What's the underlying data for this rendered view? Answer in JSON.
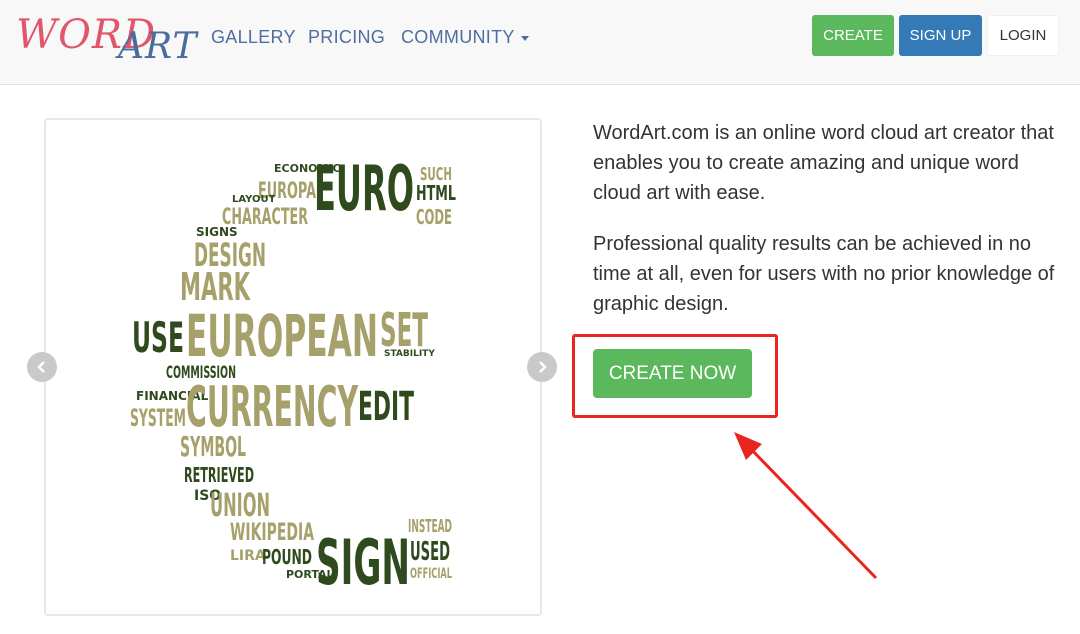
{
  "header": {
    "logo": {
      "word": "WORD",
      "art": "ART"
    },
    "nav": {
      "gallery": "GALLERY",
      "pricing": "PRICING",
      "community": "COMMUNITY"
    },
    "buttons": {
      "create": "CREATE",
      "signup": "SIGN UP",
      "login": "LOGIN"
    }
  },
  "main": {
    "description_1": "WordArt.com is an online word cloud art creator that enables you to create amazing and unique word cloud art with ease.",
    "description_2": "Professional quality results can be achieved in no time at all, even for users with no prior knowledge of graphic design.",
    "create_now": "CREATE NOW"
  },
  "word_cloud": {
    "words": [
      {
        "t": "EURO",
        "c": "dark"
      },
      {
        "t": "EUROPA",
        "c": "olive"
      },
      {
        "t": "ECONOMIC",
        "c": "dark"
      },
      {
        "t": "SUCH",
        "c": "olive"
      },
      {
        "t": "HTML",
        "c": "dark"
      },
      {
        "t": "CODE",
        "c": "olive"
      },
      {
        "t": "CHARACTER",
        "c": "olive"
      },
      {
        "t": "LAYOUT",
        "c": "dark"
      },
      {
        "t": "DESIGN",
        "c": "olive"
      },
      {
        "t": "SIGNS",
        "c": "dark"
      },
      {
        "t": "MARK",
        "c": "olive"
      },
      {
        "t": "USE",
        "c": "dark"
      },
      {
        "t": "EUROPEAN",
        "c": "olive"
      },
      {
        "t": "SET",
        "c": "olive"
      },
      {
        "t": "COMMISSION",
        "c": "dark"
      },
      {
        "t": "FINANCIAL",
        "c": "dark"
      },
      {
        "t": "CURRENCY",
        "c": "olive"
      },
      {
        "t": "EDIT",
        "c": "dark"
      },
      {
        "t": "SYSTEM",
        "c": "olive"
      },
      {
        "t": "SYMBOL",
        "c": "olive"
      },
      {
        "t": "RETRIEVED",
        "c": "dark"
      },
      {
        "t": "ISO",
        "c": "dark"
      },
      {
        "t": "UNION",
        "c": "olive"
      },
      {
        "t": "WIKIPEDIA",
        "c": "olive"
      },
      {
        "t": "LIRA",
        "c": "olive"
      },
      {
        "t": "POUND",
        "c": "dark"
      },
      {
        "t": "SIGN",
        "c": "dark"
      },
      {
        "t": "INSTEAD",
        "c": "olive"
      },
      {
        "t": "USED",
        "c": "dark"
      },
      {
        "t": "OFFICIAL",
        "c": "olive"
      },
      {
        "t": "PORTAL",
        "c": "dark"
      },
      {
        "t": "STABILITY",
        "c": "dark"
      }
    ],
    "colors": {
      "dark": "#2f4a1c",
      "olive": "#a6a06a"
    }
  }
}
